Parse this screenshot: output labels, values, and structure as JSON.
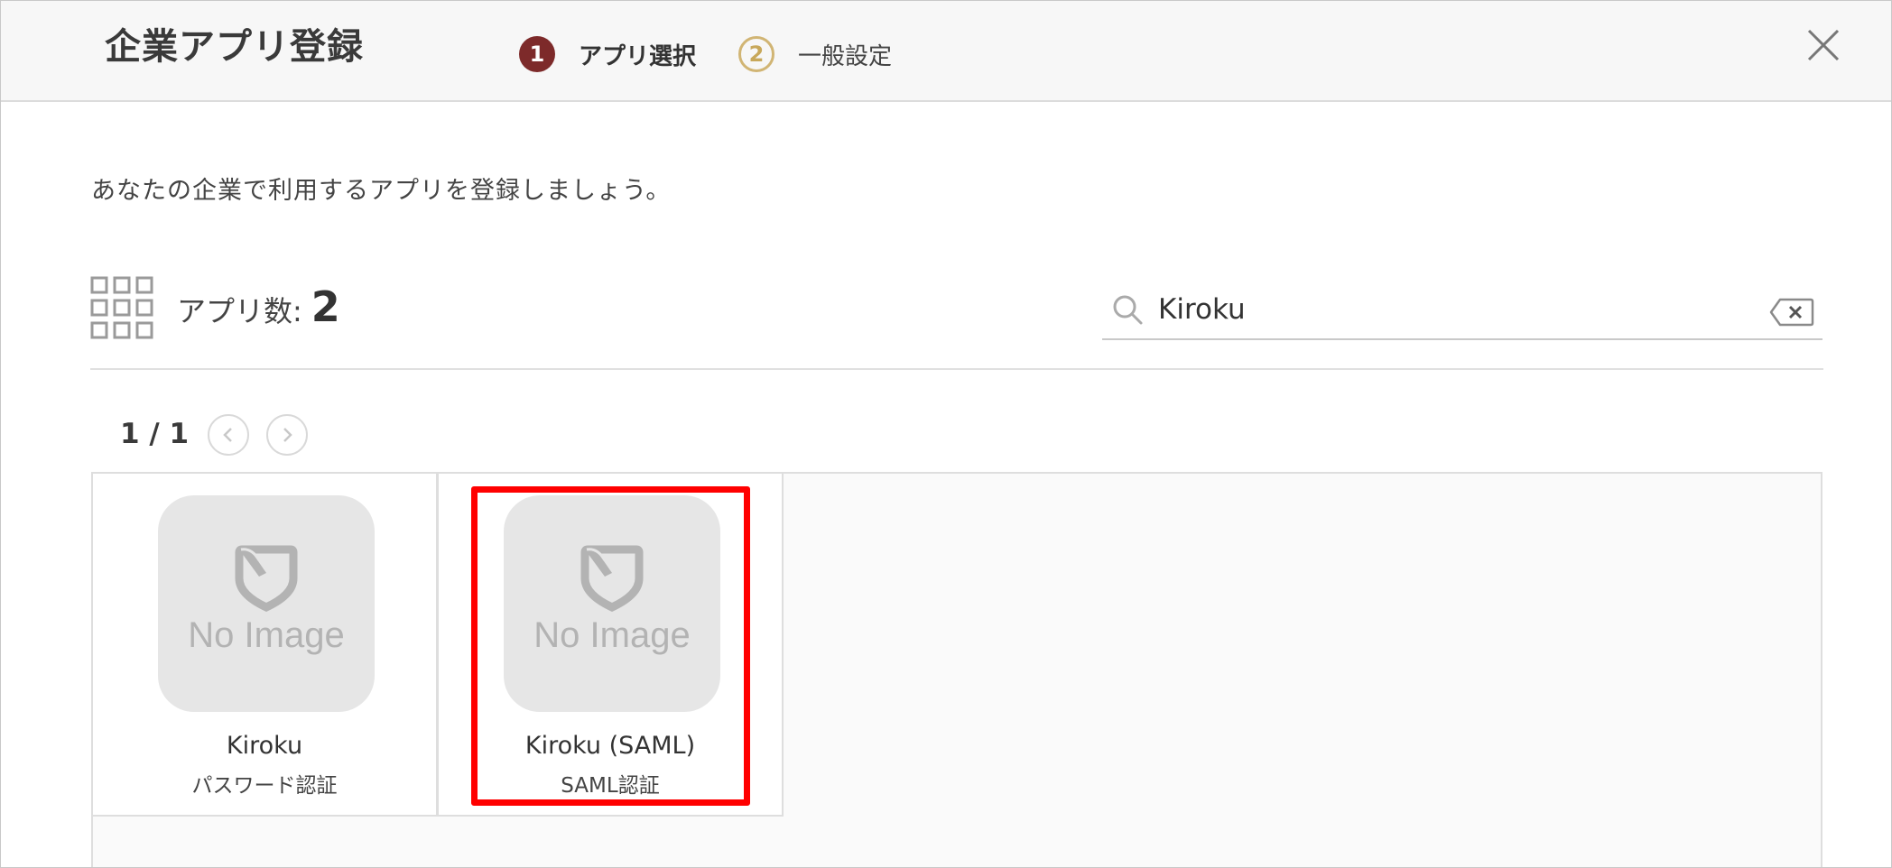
{
  "header": {
    "title": "企業アプリ登録",
    "steps": [
      {
        "number": "1",
        "label": "アプリ選択",
        "state": "active"
      },
      {
        "number": "2",
        "label": "一般設定",
        "state": "inactive"
      }
    ],
    "close_icon": "close-icon"
  },
  "description": "あなたの企業で利用するアプリを登録しましょう。",
  "toolbar": {
    "grid_icon": "grid-icon",
    "app_count_label": "アプリ数:",
    "app_count": "2",
    "search": {
      "value": "Kiroku",
      "search_icon": "search-icon",
      "clear_icon": "clear-input-icon"
    }
  },
  "pagination": {
    "text": "1 / 1",
    "prev_icon": "chevron-left-icon",
    "next_icon": "chevron-right-icon"
  },
  "apps": [
    {
      "name": "Kiroku",
      "auth": "パスワード認証",
      "image": "no-image-placeholder",
      "selected": false
    },
    {
      "name": "Kiroku (SAML)",
      "auth": "SAML認証",
      "image": "no-image-placeholder",
      "selected": true
    }
  ],
  "colors": {
    "step_active": "#7d2a2a",
    "step_inactive": "#d1b574",
    "highlight": "#ff0000",
    "placeholder_bg": "#e6e6e6",
    "placeholder_fg": "#b3b3b3"
  }
}
